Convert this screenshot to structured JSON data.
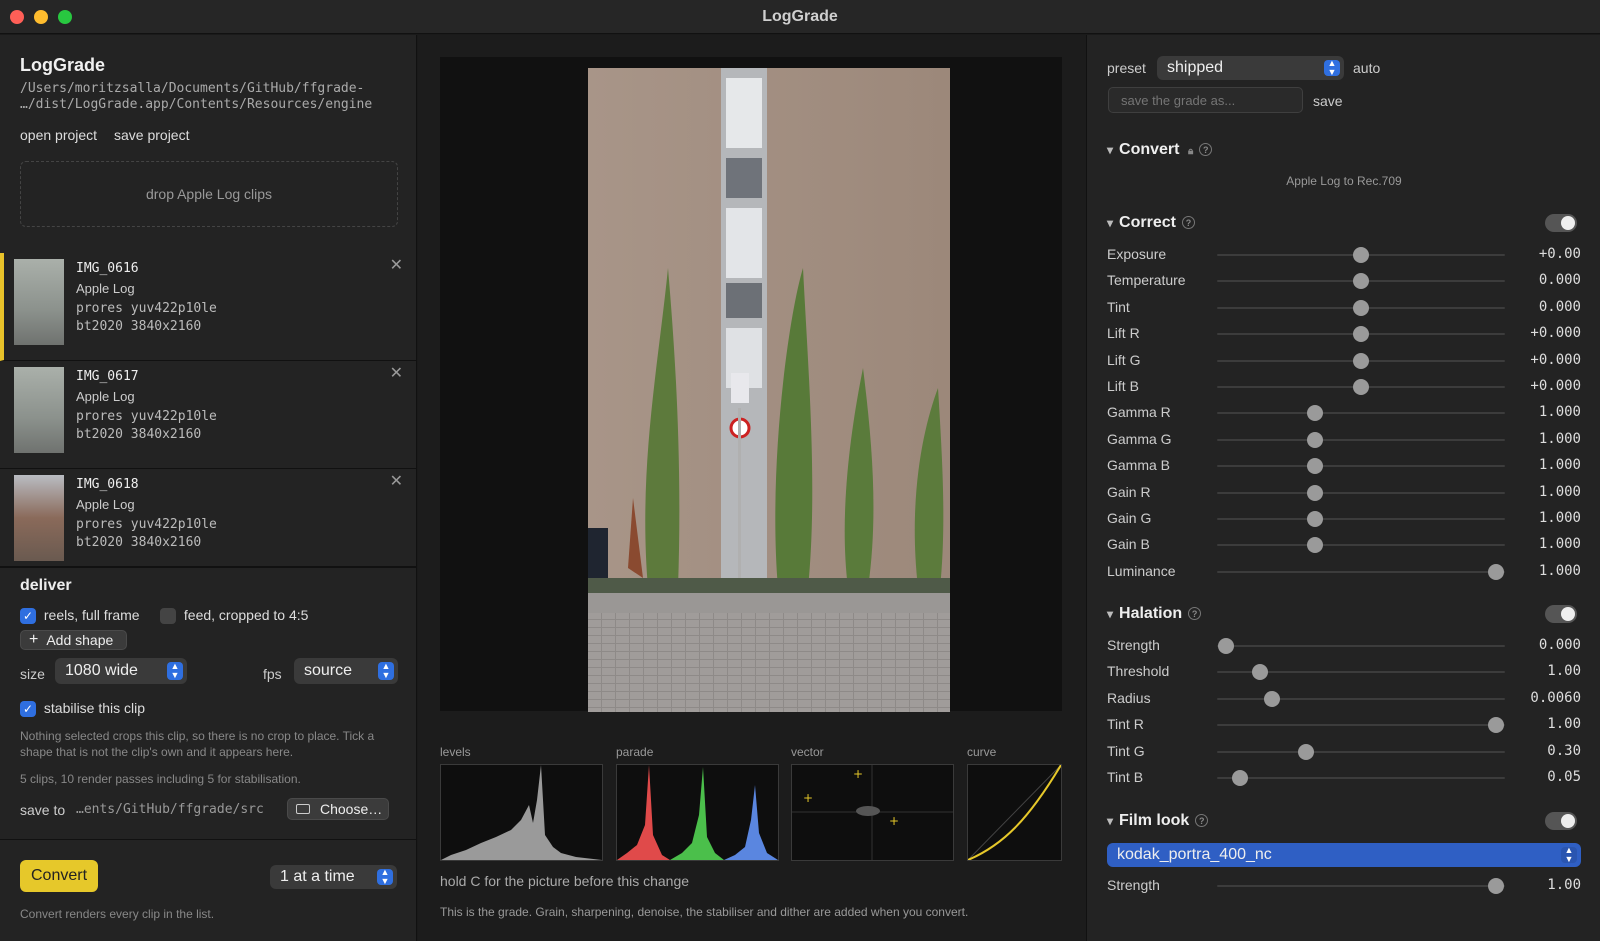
{
  "window": {
    "title": "LogGrade"
  },
  "sidebar": {
    "app_name": "LogGrade",
    "path_line1": "/Users/moritzsalla/Documents/GitHub/ffgrade-",
    "path_line2": "…/dist/LogGrade.app/Contents/Resources/engine",
    "open_project": "open project",
    "save_project": "save project",
    "drop_text": "drop Apple Log clips",
    "clips": [
      {
        "name": "IMG_0616",
        "type": "Apple Log",
        "codec": "prores yuv422p10le",
        "space": "bt2020 3840x2160"
      },
      {
        "name": "IMG_0617",
        "type": "Apple Log",
        "codec": "prores yuv422p10le",
        "space": "bt2020 3840x2160"
      },
      {
        "name": "IMG_0618",
        "type": "Apple Log",
        "codec": "prores yuv422p10le",
        "space": "bt2020 3840x2160"
      }
    ],
    "close_glyph": "✕",
    "deliver": {
      "title": "deliver",
      "reels_label": "reels, full frame",
      "reels_checked": true,
      "feed_label": "feed, cropped to 4:5",
      "feed_checked": false,
      "add_shape": "Add shape",
      "size_label": "size",
      "size_value": "1080 wide",
      "fps_label": "fps",
      "fps_value": "source",
      "stabilise_label": "stabilise this clip",
      "stabilise_checked": true,
      "note1": "Nothing selected crops this clip, so there is no crop to place. Tick a shape that is not the clip's own and it appears here.",
      "note2": "5 clips, 10 render passes including 5 for stabilisation.",
      "save_to_label": "save to",
      "save_to_path": "…ents/GitHub/ffgrade/src",
      "choose": "Choose…"
    },
    "convert_button": "Convert",
    "concurrency": "1 at a time",
    "convert_note": "Convert renders every clip in the list."
  },
  "center": {
    "scopes": [
      "levels",
      "parade",
      "vector",
      "curve"
    ],
    "hint": "hold C for the picture before this change",
    "footer": "This is the grade. Grain, sharpening, denoise, the stabiliser and dither are added when you convert."
  },
  "panel": {
    "preset_label": "preset",
    "preset_value": "shipped",
    "auto": "auto",
    "save_placeholder": "save the grade as...",
    "save": "save",
    "convert": {
      "title": "Convert",
      "subtitle": "Apple Log to Rec.709"
    },
    "correct": {
      "title": "Correct",
      "enabled": true,
      "sliders": [
        {
          "name": "Exposure",
          "value": "+0.00",
          "pos": 0.5
        },
        {
          "name": "Temperature",
          "value": "0.000",
          "pos": 0.5
        },
        {
          "name": "Tint",
          "value": "0.000",
          "pos": 0.5
        },
        {
          "name": "Lift R",
          "value": "+0.000",
          "pos": 0.5
        },
        {
          "name": "Lift G",
          "value": "+0.000",
          "pos": 0.5
        },
        {
          "name": "Lift B",
          "value": "+0.000",
          "pos": 0.5
        },
        {
          "name": "Gamma R",
          "value": "1.000",
          "pos": 0.34
        },
        {
          "name": "Gamma G",
          "value": "1.000",
          "pos": 0.34
        },
        {
          "name": "Gamma B",
          "value": "1.000",
          "pos": 0.34
        },
        {
          "name": "Gain R",
          "value": "1.000",
          "pos": 0.34
        },
        {
          "name": "Gain G",
          "value": "1.000",
          "pos": 0.34
        },
        {
          "name": "Gain B",
          "value": "1.000",
          "pos": 0.34
        },
        {
          "name": "Luminance",
          "value": "1.000",
          "pos": 0.97
        }
      ]
    },
    "halation": {
      "title": "Halation",
      "enabled": true,
      "sliders": [
        {
          "name": "Strength",
          "value": "0.000",
          "pos": 0.03
        },
        {
          "name": "Threshold",
          "value": "1.00",
          "pos": 0.15
        },
        {
          "name": "Radius",
          "value": "0.0060",
          "pos": 0.19
        },
        {
          "name": "Tint R",
          "value": "1.00",
          "pos": 0.97
        },
        {
          "name": "Tint G",
          "value": "0.30",
          "pos": 0.31
        },
        {
          "name": "Tint B",
          "value": "0.05",
          "pos": 0.08
        }
      ]
    },
    "film_look": {
      "title": "Film look",
      "enabled": true,
      "stock": "kodak_portra_400_nc",
      "sliders": [
        {
          "name": "Strength",
          "value": "1.00",
          "pos": 0.97
        }
      ]
    }
  }
}
